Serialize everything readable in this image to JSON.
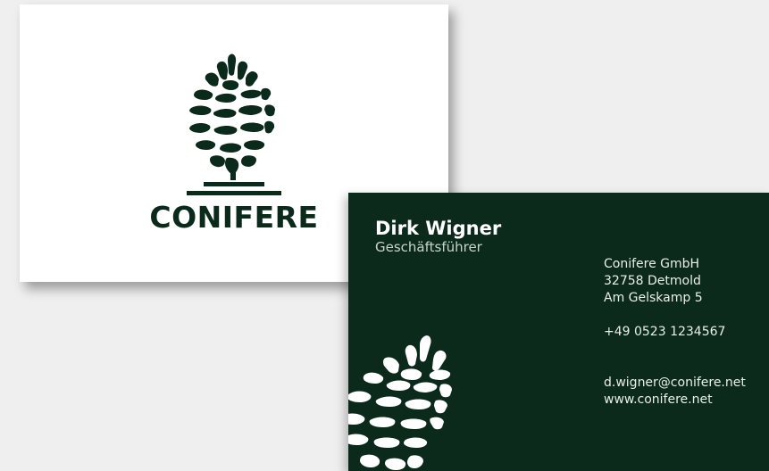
{
  "colors": {
    "dark_green": "#0c2a1b",
    "background": "#efefef",
    "card_white": "#ffffff"
  },
  "front_card": {
    "logo_icon": "pinecone-icon",
    "brand": "CONIFERE"
  },
  "back_card": {
    "name": "Dirk Wigner",
    "role": "Geschäftsführer",
    "company": "Conifere GmbH",
    "city": "32758 Detmold",
    "street": "Am Gelskamp 5",
    "phone": "+49 0523 1234567",
    "email": "d.wigner@conifere.net",
    "website": "www.conifere.net",
    "logo_icon": "pinecone-icon"
  }
}
